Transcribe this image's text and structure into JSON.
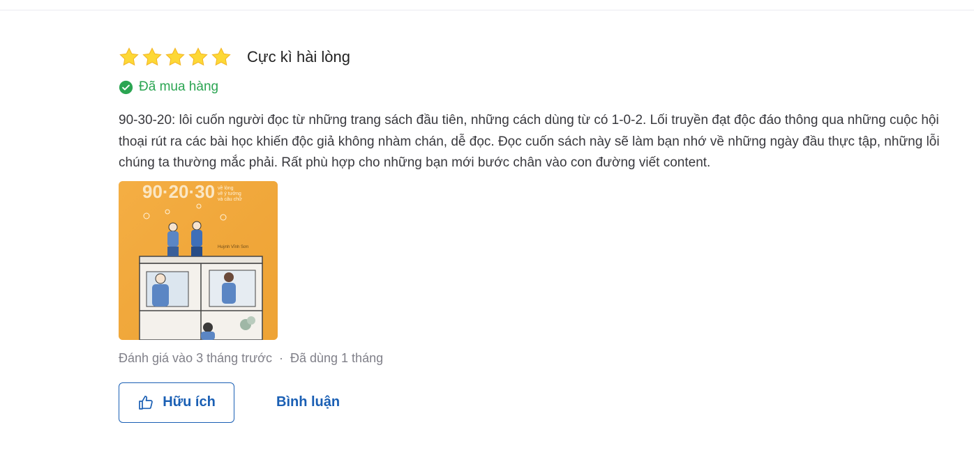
{
  "review": {
    "rating": 5,
    "max_rating": 5,
    "title": "Cực kì hài lòng",
    "purchased_label": "Đã mua hàng",
    "content": "90-30-20: lôi cuốn người đọc từ những trang sách đầu tiên, những cách dùng từ có 1-0-2. Lối truyền đạt độc đáo thông qua những cuộc hội thoại rút ra các bài học khiến độc giả không nhàm chán, dễ đọc. Đọc cuốn sách này sẽ làm bạn nhớ về những ngày đầu thực tập, những lỗi chúng ta thường mắc phải. Rất phù hợp cho những bạn mới bước chân vào con đường viết content.",
    "photo": {
      "cover_title": "90·20·30",
      "cover_subtitle": "90 lòng\nvề ý tưởng\nvà câu chữ",
      "author": "Huỳnh Vĩnh Sơn"
    },
    "reviewed_time": "Đánh giá vào 3 tháng trước",
    "separator": "·",
    "usage_time": "Đã dùng 1 tháng"
  },
  "actions": {
    "helpful_label": "Hữu ích",
    "comment_label": "Bình luận"
  },
  "colors": {
    "star": "#fdd836",
    "purchased": "#2ba552",
    "link": "#1a5fb4",
    "meta": "#808089",
    "book_cover": "#f2a93b"
  },
  "icons": {
    "star": "star-icon",
    "purchased": "check-circle-icon",
    "helpful": "thumbs-up-icon"
  }
}
